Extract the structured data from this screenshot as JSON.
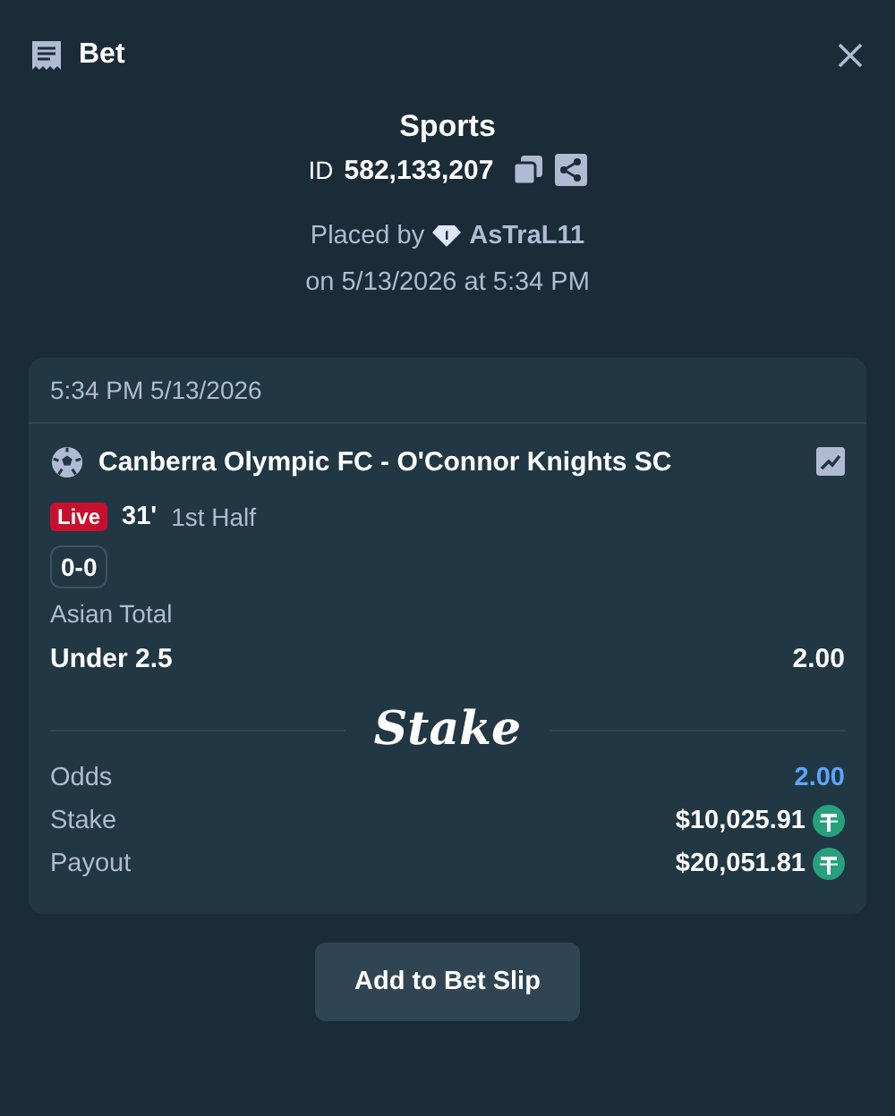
{
  "header": {
    "title": "Bet"
  },
  "summary": {
    "category": "Sports",
    "id_label": "ID",
    "id_value": "582,133,207",
    "placed_by_label": "Placed by",
    "username": "AsTraL11",
    "placed_on": "on 5/13/2026 at 5:34 PM"
  },
  "card": {
    "timestamp": "5:34 PM 5/13/2026",
    "match": "Canberra Olympic FC - O'Connor Knights SC",
    "live": true,
    "live_label": "Live",
    "minute": "31'",
    "period": "1st Half",
    "score": "0-0",
    "market": "Asian Total",
    "selection": "Under 2.5",
    "selection_odds": "2.00",
    "logo": "Stake",
    "details": [
      {
        "label": "Odds",
        "value": "2.00",
        "kind": "odds"
      },
      {
        "label": "Stake",
        "value": "$10,025.91",
        "kind": "amount"
      },
      {
        "label": "Payout",
        "value": "$20,051.81",
        "kind": "amount"
      }
    ]
  },
  "button": "Add to Bet Slip"
}
